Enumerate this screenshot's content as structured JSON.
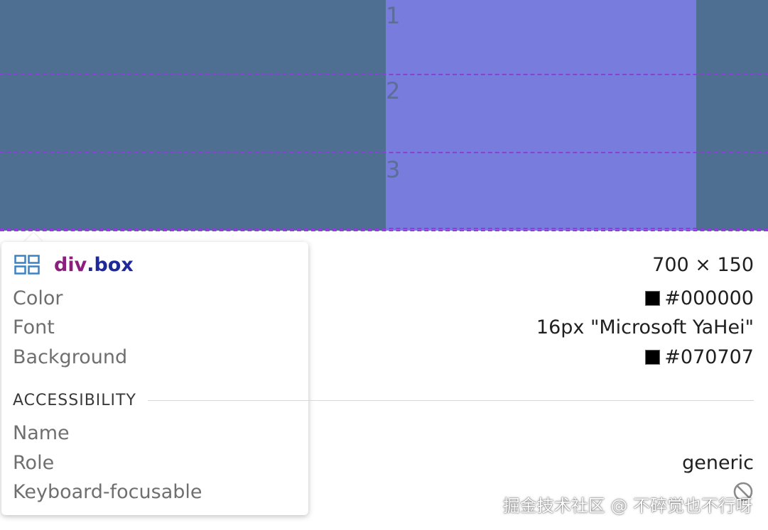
{
  "grid": {
    "rows": [
      "1",
      "2",
      "3"
    ]
  },
  "inspector": {
    "selector_tag": "div",
    "selector_class": ".box",
    "size": "700 × 150",
    "color_label": "Color",
    "color_value": "#000000",
    "font_label": "Font",
    "font_value": "16px \"Microsoft YaHei\"",
    "background_label": "Background",
    "background_value": "#070707",
    "accessibility_title": "ACCESSIBILITY",
    "name_label": "Name",
    "role_label": "Role",
    "role_value": "generic",
    "keyboard_label": "Keyboard-focusable"
  },
  "icons": {
    "selector": "grid-layout-icon",
    "keyboard": "not-focusable-icon"
  },
  "colors": {
    "side_bg": "#4e6f91",
    "center_bg": "#787cdc",
    "grid_line": "#8a3fd6",
    "tag": "#8a1f7d",
    "class": "#1e2a9a"
  },
  "watermark": "掘金技术社区 @ 不碎觉也不行呀"
}
